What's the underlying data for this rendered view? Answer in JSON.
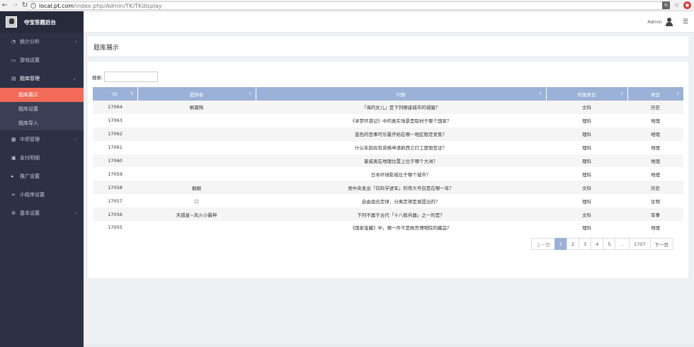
{
  "browser": {
    "url_host": "local.pt.com",
    "url_path": "/index.php/Admin/TK/TKdisplay"
  },
  "sidebar": {
    "brand": "夺宝答题后台",
    "items": [
      {
        "label": "统计分析",
        "icon": "pie-chart-icon",
        "has_chevron": true
      },
      {
        "label": "游戏设置",
        "icon": "gamepad-icon",
        "has_chevron": false
      },
      {
        "label": "题库管理",
        "icon": "table-icon",
        "has_chevron": true,
        "open": true,
        "children": [
          {
            "label": "题库展示",
            "active": true
          },
          {
            "label": "题库设置",
            "active": false
          },
          {
            "label": "题库导入",
            "active": false
          }
        ]
      },
      {
        "label": "中奖管理",
        "icon": "grid-icon",
        "has_chevron": true
      },
      {
        "label": "支付明细",
        "icon": "card-icon",
        "has_chevron": false
      },
      {
        "label": "推广设置",
        "icon": "bullhorn-icon",
        "has_chevron": false
      },
      {
        "label": "小程序设置",
        "icon": "link-icon",
        "has_chevron": false
      },
      {
        "label": "基本设置",
        "icon": "gear-icon",
        "has_chevron": true
      }
    ]
  },
  "header": {
    "admin_name": "Admin"
  },
  "page_title": "题库展示",
  "search": {
    "label": "搜索:",
    "value": ""
  },
  "table": {
    "columns": [
      "ID",
      "提供者",
      "问题",
      "所属类目",
      "类型"
    ],
    "rows": [
      [
        "17064",
        "枫霜殇",
        "「海的女儿」是下列哪座城市的城徽？",
        "文科",
        "历史"
      ],
      [
        "17063",
        "",
        "《寻梦环游记》中的真实场景是取材于哪个国家？",
        "理科",
        "地理"
      ],
      [
        "17062",
        "",
        "蓝色的百事可乐最开始在哪一地区限定发售？",
        "理科",
        "地理"
      ],
      [
        "17061",
        "",
        "什么年龄段有资格申请新西兰打工度假签证？",
        "理科",
        "地理"
      ],
      [
        "17060",
        "",
        "夏威夷在地理位置上位于哪个大洲？",
        "理科",
        "地理"
      ],
      [
        "17059",
        "",
        "日本环球影城位于哪个城市？",
        "理科",
        "地理"
      ],
      [
        "17058",
        "蝈蝈",
        "党中央发出「向科学进军」的伟大号召是在哪一年？",
        "文科",
        "历史"
      ],
      [
        "17057",
        "□",
        "自由组合定律，分离定律是谁提出的？",
        "理科",
        "生物"
      ],
      [
        "17056",
        "天孤星~风火小霸神",
        "下列不属于古代「十八般兵器」之一的是？",
        "文科",
        "军事"
      ],
      [
        "17055",
        "",
        "《国家宝藏》中，哪一件不是故宫博物院的藏品？",
        "理科",
        "地理"
      ]
    ]
  },
  "pagination": {
    "prev": "上一页",
    "pages": [
      "1",
      "2",
      "3",
      "4",
      "5",
      "…",
      "1707"
    ],
    "active": "1",
    "next": "下一页"
  }
}
